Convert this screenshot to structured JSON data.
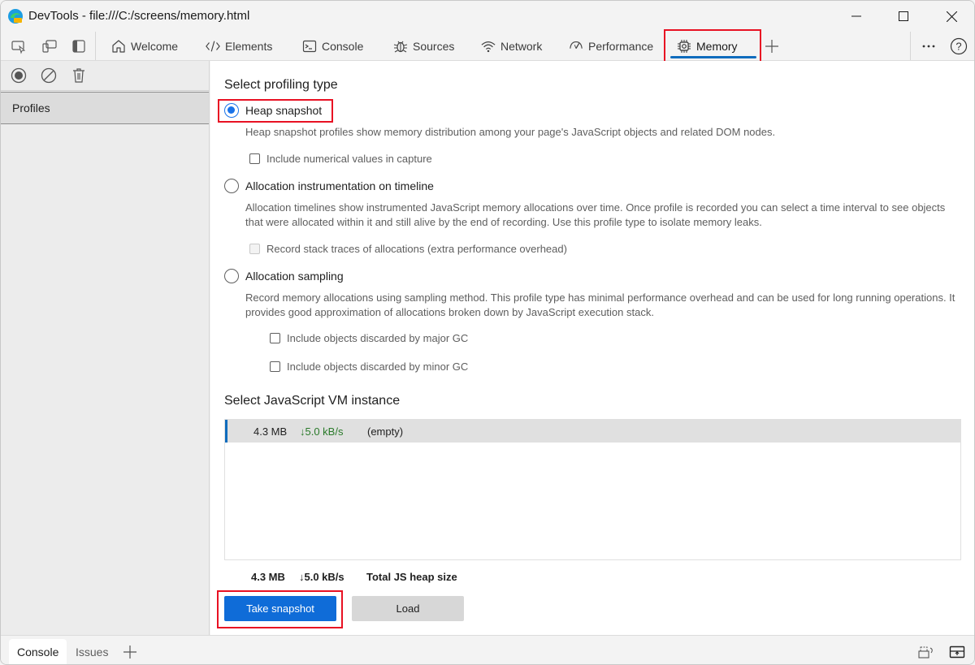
{
  "window": {
    "title": "DevTools - file:///C:/screens/memory.html",
    "controls": {
      "minimize": "minimize",
      "maximize": "maximize",
      "close": "close"
    }
  },
  "toolbar": {
    "left_icons": [
      "inspect-element-icon",
      "device-emulation-icon",
      "dock-side-icon"
    ],
    "tabs": [
      {
        "label": "Welcome",
        "icon": "home-icon",
        "active": false
      },
      {
        "label": "Elements",
        "icon": "code-icon",
        "active": false
      },
      {
        "label": "Console",
        "icon": "console-icon",
        "active": false
      },
      {
        "label": "Sources",
        "icon": "bug-icon",
        "active": false
      },
      {
        "label": "Network",
        "icon": "wifi-icon",
        "active": false
      },
      {
        "label": "Performance",
        "icon": "gauge-icon",
        "active": false
      },
      {
        "label": "Memory",
        "icon": "chip-icon",
        "active": true
      }
    ],
    "add_tab": "+",
    "more": "⋯",
    "help": "?"
  },
  "sidebar": {
    "actions": [
      "record",
      "clear",
      "delete"
    ],
    "profiles_label": "Profiles"
  },
  "main": {
    "profiling_heading": "Select profiling type",
    "options": [
      {
        "label": "Heap snapshot",
        "selected": true,
        "description": "Heap snapshot profiles show memory distribution among your page's JavaScript objects and related DOM nodes.",
        "checkboxes": [
          {
            "label": "Include numerical values in capture",
            "checked": false,
            "disabled": false
          }
        ]
      },
      {
        "label": "Allocation instrumentation on timeline",
        "selected": false,
        "description": "Allocation timelines show instrumented JavaScript memory allocations over time. Once profile is recorded you can select a time interval to see objects that were allocated within it and still alive by the end of recording. Use this profile type to isolate memory leaks.",
        "checkboxes": [
          {
            "label": "Record stack traces of allocations (extra performance overhead)",
            "checked": false,
            "disabled": true
          }
        ]
      },
      {
        "label": "Allocation sampling",
        "selected": false,
        "description": "Record memory allocations using sampling method. This profile type has minimal performance overhead and can be used for long running operations. It provides good approximation of allocations broken down by JavaScript execution stack.",
        "checkboxes": [
          {
            "label": "Include objects discarded by major GC",
            "checked": false,
            "disabled": false
          },
          {
            "label": "Include objects discarded by minor GC",
            "checked": false,
            "disabled": false
          }
        ]
      }
    ],
    "vm_heading": "Select JavaScript VM instance",
    "vm_instances": [
      {
        "size": "4.3 MB",
        "rate": "↓5.0 kB/s",
        "name": "(empty)"
      }
    ],
    "summary": {
      "size": "4.3 MB",
      "rate": "↓5.0 kB/s",
      "label": "Total JS heap size"
    },
    "buttons": {
      "primary": "Take snapshot",
      "secondary": "Load"
    }
  },
  "drawer": {
    "tabs": [
      {
        "label": "Console",
        "active": true
      },
      {
        "label": "Issues",
        "active": false
      }
    ],
    "add": "+"
  },
  "colors": {
    "accent": "#0f6cbd",
    "highlight": "#e81123",
    "rate_green": "#2a7a2a"
  }
}
